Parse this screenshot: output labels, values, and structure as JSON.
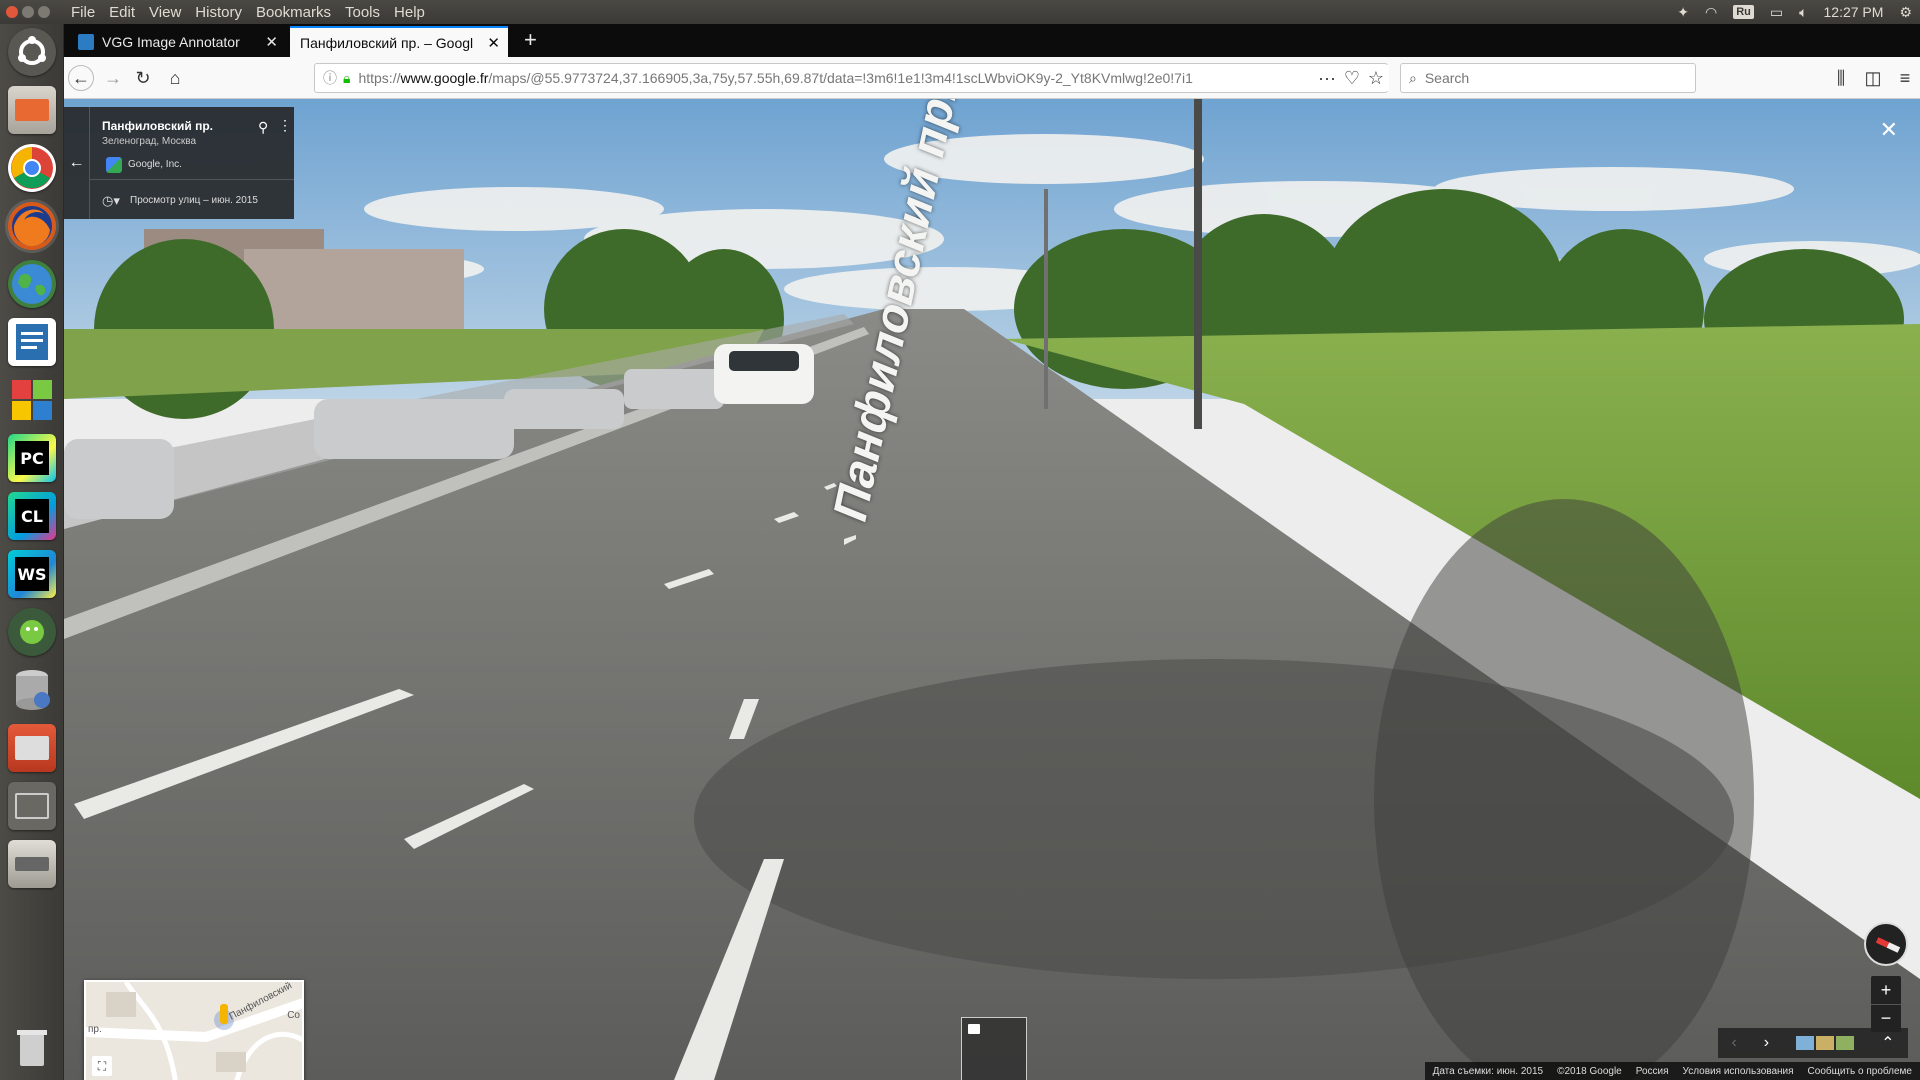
{
  "menu": {
    "items": [
      "File",
      "Edit",
      "View",
      "History",
      "Bookmarks",
      "Tools",
      "Help"
    ]
  },
  "tray": {
    "keyboard": "Ru",
    "time": "12:27 PM"
  },
  "launcher": {
    "apps": [
      "ubuntu-dash",
      "files",
      "chrome",
      "firefox",
      "globe",
      "writer",
      "workspaces",
      "pycharm",
      "clion",
      "webstorm",
      "android",
      "database",
      "files-2",
      "window",
      "drive",
      "trash"
    ]
  },
  "tabs": [
    {
      "title": "VGG Image Annotator",
      "favicon_color": "#2c7cc4"
    },
    {
      "title": "Панфиловский пр. – Googl",
      "favicon_color": "#ffffff"
    }
  ],
  "url": {
    "scheme": "https://",
    "host": "www.google.fr",
    "rest": "/maps/@55.9773724,37.166905,3a,75y,57.55h,69.87t/data=!3m6!1e1!3m4!1scLWbviOK9y-2_Yt8KVmlwg!2e0!7i1"
  },
  "search": {
    "placeholder": "Search"
  },
  "infocard": {
    "title": "Панфиловский пр.",
    "subtitle": "Зеленоград, Москва",
    "author": "Google, Inc.",
    "history": "Просмотр улиц – июн. 2015"
  },
  "road_label": "Панфиловский пр.",
  "minimap": {
    "street_label": "Панфиловский",
    "left_label": "пр.",
    "right_label": "Со"
  },
  "attribution": {
    "items": [
      "Дата съемки: июн. 2015",
      "©2018 Google",
      "Россия",
      "Условия использования",
      "Сообщить о проблеме"
    ]
  },
  "colors": {
    "sky": "#7aaed8",
    "road": "#6a6a66",
    "grass": "#6f9a3a",
    "accent": "#0a84ff"
  }
}
